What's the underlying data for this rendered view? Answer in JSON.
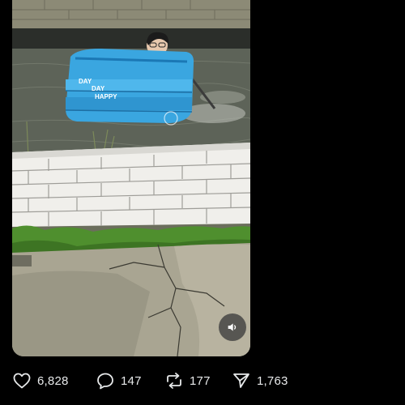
{
  "post": {
    "media": {
      "type": "video",
      "pool_text_line1": "DAY",
      "pool_text_line2": "DAY",
      "pool_text_line3": "HAPPY",
      "sound_icon": "speaker-icon"
    },
    "actions": {
      "likes": "6,828",
      "replies": "147",
      "reposts": "177",
      "shares": "1,763"
    }
  },
  "colors": {
    "background": "#000000",
    "text": "#e7e9ea",
    "pool": "#3aa6e0"
  }
}
